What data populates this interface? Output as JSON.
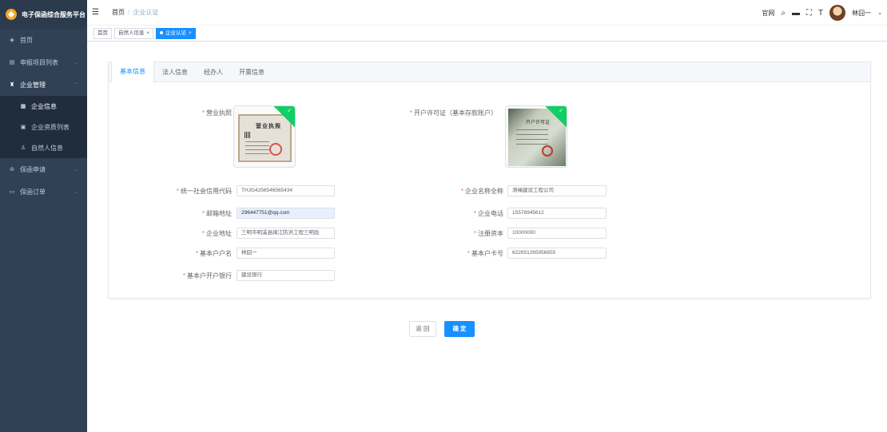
{
  "app": {
    "title": "电子保函综合服务平台"
  },
  "sidebar": {
    "items": [
      {
        "label": "首页",
        "icon": "dashboard-icon"
      },
      {
        "label": "申报项目列表",
        "icon": "project-list-icon"
      },
      {
        "label": "企业管理",
        "icon": "enterprise-icon"
      },
      {
        "label": "保函申请",
        "icon": "apply-icon"
      },
      {
        "label": "保函订单",
        "icon": "order-icon"
      }
    ],
    "submenu": [
      {
        "label": "企业信息",
        "icon": "building-icon"
      },
      {
        "label": "企业资质列表",
        "icon": "qualification-icon"
      },
      {
        "label": "自然人信息",
        "icon": "person-icon"
      }
    ]
  },
  "navbar": {
    "breadcrumb_home": "首页",
    "breadcrumb_sep": "/",
    "breadcrumb_current": "企业认证",
    "official_site": "官网",
    "user_name": "林囧一"
  },
  "tags": [
    {
      "label": "首页"
    },
    {
      "label": "自然人信息"
    },
    {
      "label": "企业认证"
    }
  ],
  "tabs": [
    "基本信息",
    "法人信息",
    "经办人",
    "开票信息"
  ],
  "form": {
    "business_license_label": "营业执照",
    "account_permit_label": "开户许可证（基本存款账户）",
    "license_image_text": "营业执照",
    "permit_image_text": "开户许可证",
    "credit_code": {
      "label": "统一社会信用代码",
      "value": "THJG4256546565434"
    },
    "company_name": {
      "label": "企业名称全称",
      "value": "测绳建设工程公司"
    },
    "email": {
      "label": "邮箱地址",
      "value": "296447751@qq.com"
    },
    "phone": {
      "label": "企业电话",
      "value": "15578945612"
    },
    "address": {
      "label": "企业地址",
      "value": "三明市明溪县闽江防洪工程三明段"
    },
    "capital": {
      "label": "注册资本",
      "value": "10000000"
    },
    "account_name": {
      "label": "基本户户名",
      "value": "林囧一"
    },
    "account_number": {
      "label": "基本户卡号",
      "value": "622651265956655"
    },
    "bank": {
      "label": "基本户开户银行",
      "value": "建设银行"
    }
  },
  "buttons": {
    "back": "返 回",
    "confirm": "确 定"
  },
  "colors": {
    "primary": "#1890ff",
    "sidebar": "#304156",
    "success": "#13ce66",
    "required": "#f56c6c"
  }
}
